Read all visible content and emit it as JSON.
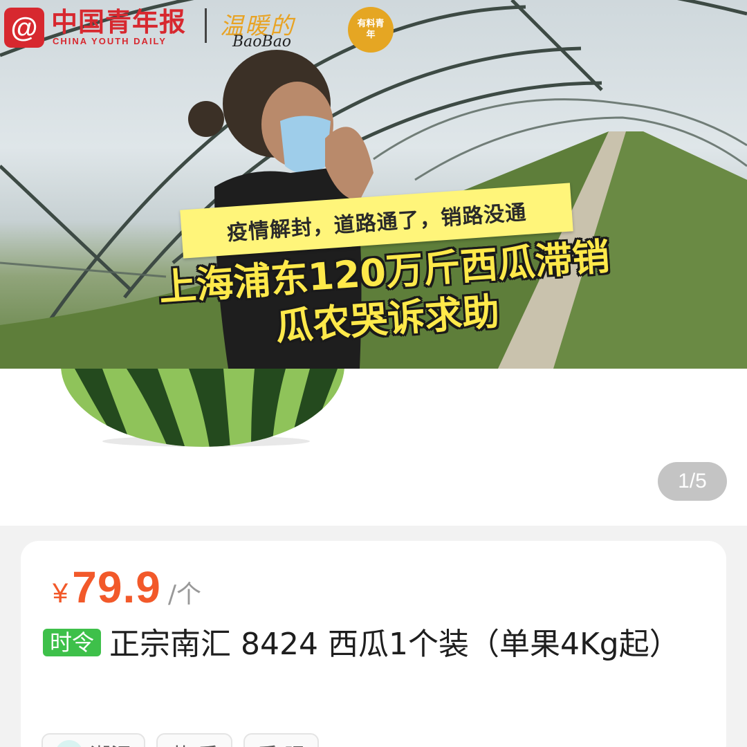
{
  "brand": {
    "logo_mark": "@",
    "name_cn": "中国青年报",
    "name_en": "CHINA YOUTH DAILY",
    "cute_cn": "温暖的",
    "cute_en": "BaoBao",
    "badge": "有料青年"
  },
  "headline": {
    "sub": "疫情解封，道路通了，销路没通",
    "line1": "上海浦东120万斤西瓜滞销",
    "line2": "瓜农哭诉求助"
  },
  "gallery": {
    "page_indicator": "1/5"
  },
  "product": {
    "currency": "¥",
    "price": "79.9",
    "unit": "/个",
    "tag": "时令",
    "title": "正宗南汇 8424 西瓜1个装（单果4Kg起）"
  },
  "chips": [
    {
      "label": "潮泥",
      "icon": "shop-icon"
    },
    {
      "label": "草  质",
      "icon": ""
    },
    {
      "label": "质  眼",
      "icon": ""
    }
  ],
  "colors": {
    "price": "#f2592a",
    "tag": "#3ec04a",
    "brand_red": "#d7282f",
    "caption_yellow": "#ffe94a"
  }
}
